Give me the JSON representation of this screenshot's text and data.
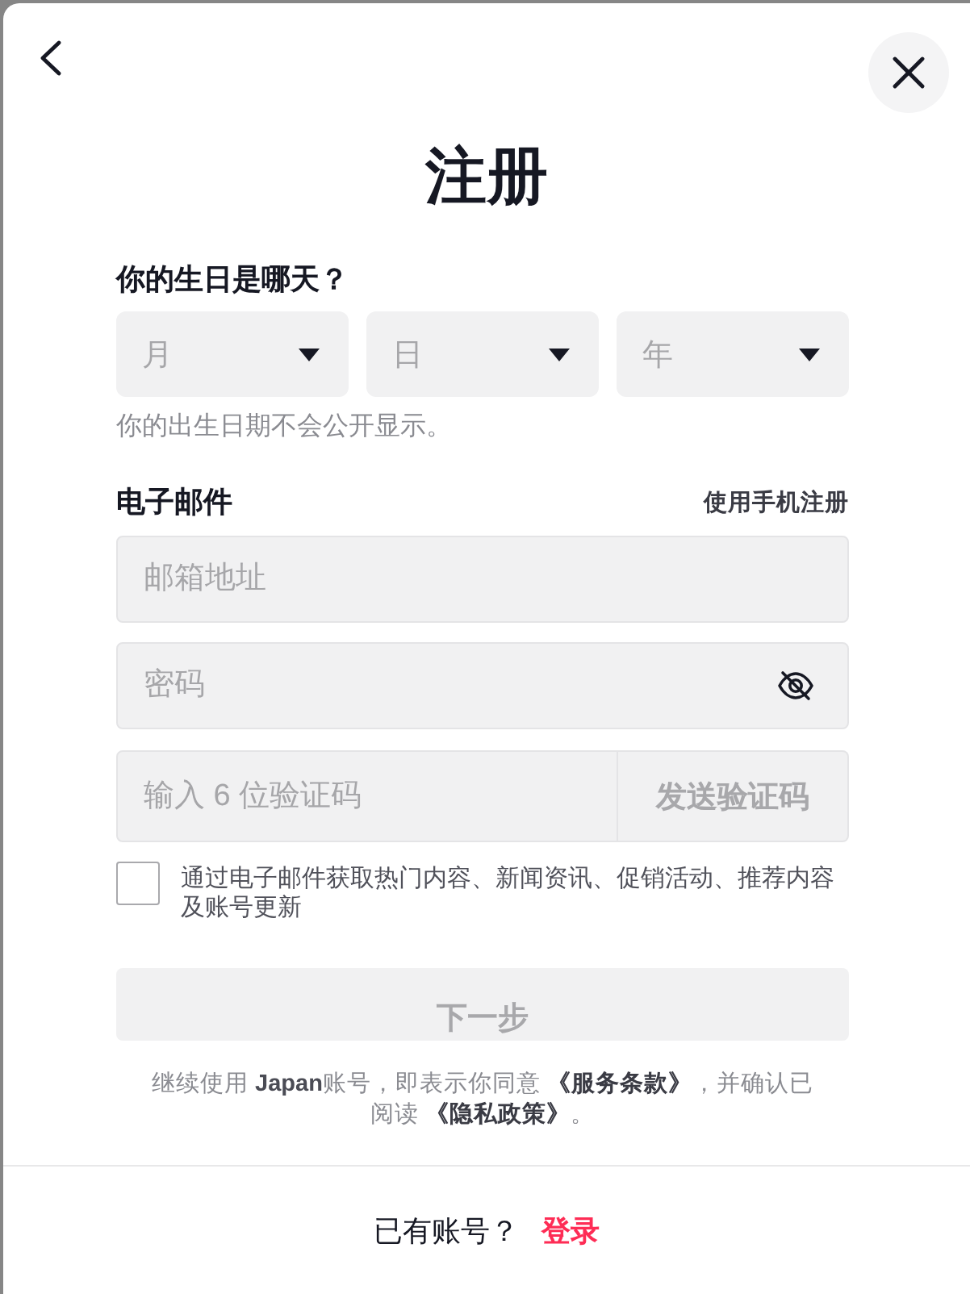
{
  "header": {
    "title": "注册"
  },
  "birthday": {
    "label": "你的生日是哪天？",
    "selects": [
      {
        "placeholder": "月"
      },
      {
        "placeholder": "日"
      },
      {
        "placeholder": "年"
      }
    ],
    "hint": "你的出生日期不会公开显示。"
  },
  "email": {
    "label": "电子邮件",
    "switch_link": "使用手机注册",
    "fields": [
      {
        "kind": "text",
        "placeholder": "邮箱地址"
      },
      {
        "kind": "password",
        "placeholder": "密码"
      },
      {
        "kind": "code",
        "placeholder": "输入 6 位验证码",
        "button": {
          "label": "发送验证码",
          "disabled": true
        }
      }
    ]
  },
  "marketing_opt_in": {
    "checked": false,
    "label": "通过电子邮件获取热门内容、新闻资讯、促销活动、推荐内容及账号更新"
  },
  "next_button": {
    "label": "下一步",
    "disabled": true
  },
  "terms": [
    {
      "kind": "text",
      "text": "继续使用 **Japan**账号，即表示你同意 "
    },
    {
      "kind": "link",
      "text": "《服务条款》"
    },
    {
      "kind": "text",
      "text": "，并确认已阅读 "
    },
    {
      "kind": "link",
      "text": "《隐私政策》"
    },
    {
      "kind": "text",
      "text": "。"
    }
  ],
  "footer": {
    "prompt": "已有账号？",
    "link": "登录"
  }
}
